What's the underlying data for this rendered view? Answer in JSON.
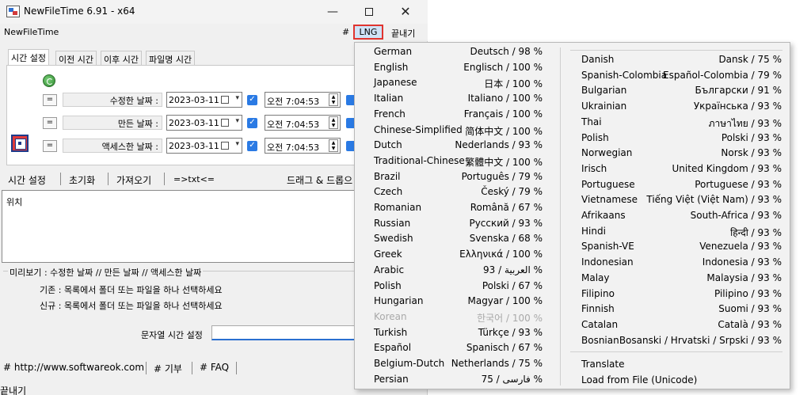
{
  "window": {
    "title": "NewFileTime 6.91 - x64",
    "min_glyph": "—",
    "max_glyph": "",
    "close_glyph": "✕"
  },
  "menubar": {
    "app_name": "NewFileTime",
    "hash": "#",
    "lng": "LNG",
    "exit": "끝내기"
  },
  "tabs": [
    "시간 설정",
    "이전 시간",
    "이후 시간",
    "파일명 시간"
  ],
  "rows": [
    {
      "btn": "=",
      "label": "수정한 날짜 :",
      "date": "2023-03-11",
      "ampm_time": "오전  7:04:53"
    },
    {
      "btn": "=",
      "label": "만든 날짜 :",
      "date": "2023-03-11",
      "ampm_time": "오전  7:04:53"
    },
    {
      "btn": "=",
      "label": "액세스한 날짜 :",
      "date": "2023-03-11",
      "ampm_time": "오전  7:04:53"
    }
  ],
  "toolbar2": {
    "set_time": "시간 설정",
    "reset": "초기화",
    "import": "가져오기",
    "txt": "=>txt<=",
    "drag": "드래그 & 드롭으"
  },
  "list": {
    "header": "위치"
  },
  "preview": {
    "title": "미리보기 :  수정한 날짜  //  만든 날짜  //  액세스한 날짜",
    "base": "기존 : 목록에서 폴더 또는 파일을 하나 선택하세요",
    "new": "신규 : 목록에서 폴더 또는 파일을 하나 선택하세요"
  },
  "string_time": {
    "label": "문자열 시간 설정"
  },
  "status": {
    "website": "# http://www.softwareok.com",
    "donate": "# 기부",
    "faq": "# FAQ"
  },
  "bottom_label": "끝내기",
  "language_menu": {
    "col1": [
      {
        "name": "German",
        "value": "Deutsch / 98 %"
      },
      {
        "name": "English",
        "value": "Englisch / 100 %"
      },
      {
        "name": "Japanese",
        "value": "日本 / 100 %"
      },
      {
        "name": "Italian",
        "value": "Italiano / 100 %"
      },
      {
        "name": "French",
        "value": "Français / 100 %"
      },
      {
        "name": "Chinese-Simplified",
        "value": "简体中文 / 100 %"
      },
      {
        "name": "Dutch",
        "value": "Nederlands / 93 %"
      },
      {
        "name": "Traditional-Chinese",
        "value": "繁體中文 / 100 %"
      },
      {
        "name": "Brazil",
        "value": "Português / 79 %"
      },
      {
        "name": "Czech",
        "value": "Český / 79 %"
      },
      {
        "name": "Romanian",
        "value": "Română / 67 %"
      },
      {
        "name": "Russian",
        "value": "Русский / 93 %"
      },
      {
        "name": "Swedish",
        "value": "Svenska / 68 %"
      },
      {
        "name": "Greek",
        "value": "Ελληνικά / 100 %"
      },
      {
        "name": "Arabic",
        "value": "93 / العربية %"
      },
      {
        "name": "Polish",
        "value": "Polski / 67 %"
      },
      {
        "name": "Hungarian",
        "value": "Magyar / 100 %"
      },
      {
        "name": "Korean",
        "value": "한국어 / 100 %",
        "disabled": true
      },
      {
        "name": "Turkish",
        "value": "Türkçe / 93 %"
      },
      {
        "name": "Español",
        "value": "Spanisch / 67 %"
      },
      {
        "name": "Belgium-Dutch",
        "value": "Netherlands / 75 %"
      },
      {
        "name": "Persian",
        "value": "75 / فارسی %"
      }
    ],
    "col2": [
      {
        "name": "Danish",
        "value": "Dansk / 75 %"
      },
      {
        "name": "Spanish-Colombia",
        "value": "Español-Colombia / 79 %"
      },
      {
        "name": "Bulgarian",
        "value": "Български / 91 %"
      },
      {
        "name": "Ukrainian",
        "value": "Українська / 93 %"
      },
      {
        "name": "Thai",
        "value": "ภาษาไทย / 93 %"
      },
      {
        "name": "Polish",
        "value": "Polski / 93 %"
      },
      {
        "name": "Norwegian",
        "value": "Norsk / 93 %"
      },
      {
        "name": "Irisch",
        "value": "United Kingdom / 93 %"
      },
      {
        "name": "Portuguese",
        "value": "Portuguese / 93 %"
      },
      {
        "name": "Vietnamese",
        "value": "Tiếng Việt (Việt Nam) / 93 %"
      },
      {
        "name": "Afrikaans",
        "value": "South-Africa / 93 %"
      },
      {
        "name": "Hindi",
        "value": "हिन्दी / 93 %"
      },
      {
        "name": "Spanish-VE",
        "value": "Venezuela / 93 %"
      },
      {
        "name": "Indonesian",
        "value": "Indonesia / 93 %"
      },
      {
        "name": "Malay",
        "value": "Malaysia / 93 %"
      },
      {
        "name": "Filipino",
        "value": "Pilipino / 93 %"
      },
      {
        "name": "Finnish",
        "value": "Suomi / 93 %"
      },
      {
        "name": "Catalan",
        "value": "Català / 93 %"
      },
      {
        "name": "Bosnian",
        "value": "Bosanski / Hrvatski / Srpski / 93 %"
      }
    ],
    "extra": [
      "Translate",
      "Load from File (Unicode)"
    ]
  }
}
